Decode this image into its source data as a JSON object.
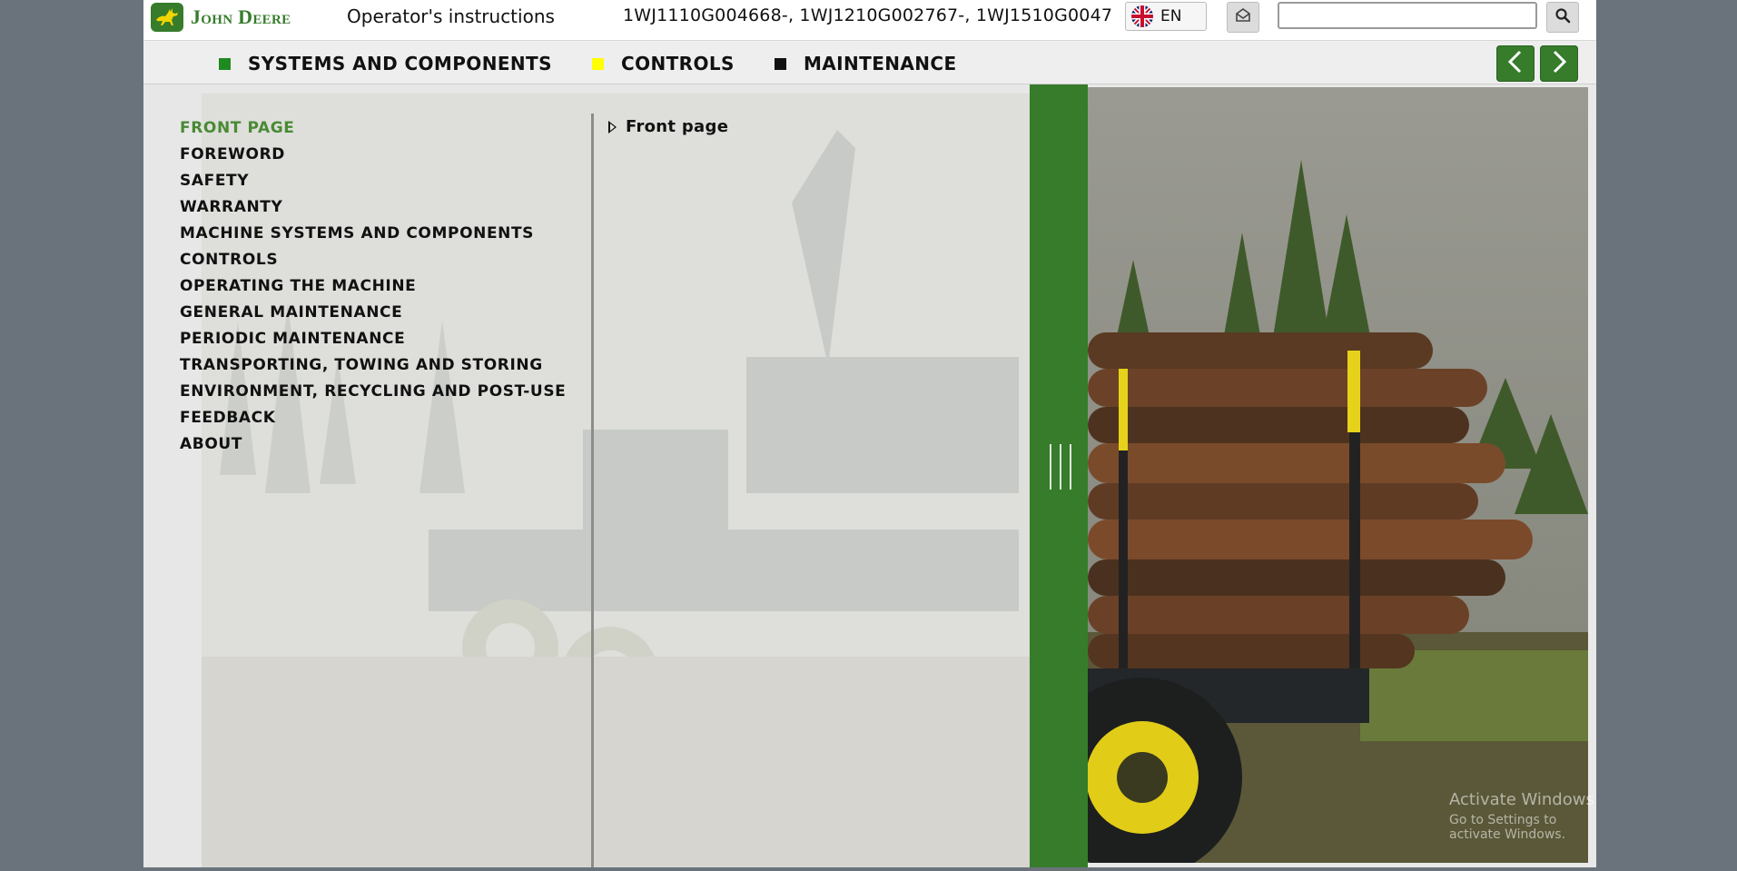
{
  "header": {
    "brand": "John Deere",
    "doc_title": "Operator's instructions",
    "serials": "1WJ1110G004668-, 1WJ1210G002767-, 1WJ1510G0047",
    "language": "EN",
    "search": {
      "value": "",
      "placeholder": ""
    },
    "icons": {
      "flag": "uk-flag-icon",
      "mail": "envelope-icon",
      "search": "magnifier-icon"
    }
  },
  "nav": {
    "items": [
      {
        "label": "SYSTEMS AND COMPONENTS",
        "color": "#1f8a1f"
      },
      {
        "label": "CONTROLS",
        "color": "#ffff00"
      },
      {
        "label": "MAINTENANCE",
        "color": "#111111"
      }
    ],
    "prev_icon": "chevron-left-icon",
    "next_icon": "chevron-right-icon"
  },
  "toc": {
    "items": [
      {
        "label": "FRONT PAGE",
        "active": true
      },
      {
        "label": "FOREWORD"
      },
      {
        "label": "SAFETY"
      },
      {
        "label": "WARRANTY"
      },
      {
        "label": "MACHINE SYSTEMS AND COMPONENTS"
      },
      {
        "label": "CONTROLS"
      },
      {
        "label": "OPERATING THE MACHINE"
      },
      {
        "label": "GENERAL MAINTENANCE"
      },
      {
        "label": "PERIODIC MAINTENANCE"
      },
      {
        "label": "TRANSPORTING, TOWING AND STORING"
      },
      {
        "label": "ENVIRONMENT, RECYCLING AND POST-USE"
      },
      {
        "label": "FEEDBACK"
      },
      {
        "label": "ABOUT"
      }
    ]
  },
  "subtoc": {
    "items": [
      {
        "label": "Front page"
      }
    ]
  },
  "watermark": {
    "title": "Activate Windows",
    "subtitle": "Go to Settings to activate Windows."
  },
  "colors": {
    "brand_green": "#367c2b",
    "active_link": "#4a8a35",
    "page_bg": "#6a737b"
  }
}
